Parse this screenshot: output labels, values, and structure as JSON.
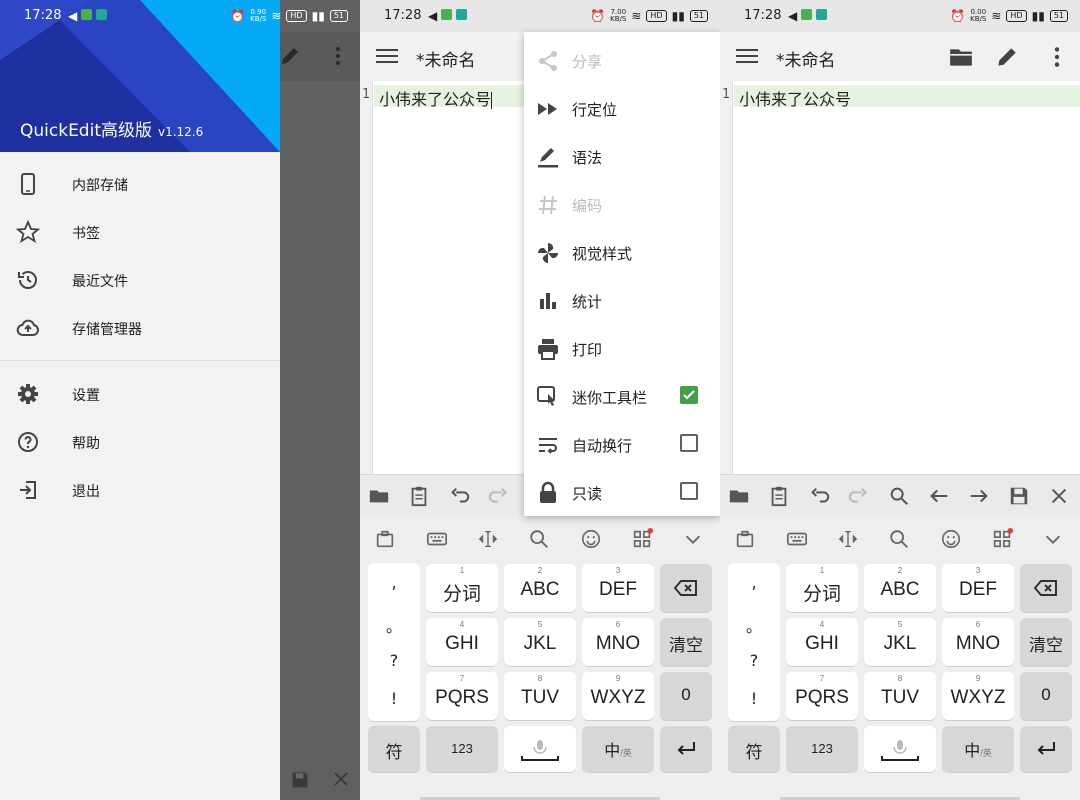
{
  "status_bar": {
    "time": "17:28",
    "speed_p1": "0.90",
    "speed_p2": "7.00",
    "speed_p3": "0.00",
    "speed_unit": "KB/S",
    "hd": "HD",
    "battery": "51"
  },
  "app": {
    "name": "QuickEdit高级版",
    "version": "v1.12.6",
    "doc_title": "*未命名"
  },
  "drawer": {
    "items": [
      {
        "label": "内部存储",
        "icon": "phone-icon"
      },
      {
        "label": "书签",
        "icon": "star-icon"
      },
      {
        "label": "最近文件",
        "icon": "history-icon"
      },
      {
        "label": "存储管理器",
        "icon": "cloud-upload-icon"
      },
      {
        "label": "设置",
        "icon": "gear-icon"
      },
      {
        "label": "帮助",
        "icon": "help-icon"
      },
      {
        "label": "退出",
        "icon": "exit-icon"
      }
    ]
  },
  "editor": {
    "line_number": "1",
    "line_text": "小伟来了公众号"
  },
  "overflow_menu": {
    "items": [
      {
        "label": "分享",
        "icon": "share-icon",
        "enabled": false
      },
      {
        "label": "行定位",
        "icon": "fast-forward-icon",
        "enabled": true
      },
      {
        "label": "语法",
        "icon": "pen-icon",
        "enabled": true
      },
      {
        "label": "编码",
        "icon": "hash-icon",
        "enabled": false
      },
      {
        "label": "视觉样式",
        "icon": "pinwheel-icon",
        "enabled": true
      },
      {
        "label": "统计",
        "icon": "bar-chart-icon",
        "enabled": true
      },
      {
        "label": "打印",
        "icon": "printer-icon",
        "enabled": true
      },
      {
        "label": "迷你工具栏",
        "icon": "touch-icon",
        "enabled": true,
        "checked": true
      },
      {
        "label": "自动换行",
        "icon": "wrap-icon",
        "enabled": true,
        "checked": false
      },
      {
        "label": "只读",
        "icon": "lock-icon",
        "enabled": true,
        "checked": false
      }
    ]
  },
  "keyboard": {
    "punct": [
      ",",
      "。",
      "?",
      "!"
    ],
    "rows": [
      [
        {
          "num": "1",
          "label": "分词"
        },
        {
          "num": "2",
          "label": "ABC"
        },
        {
          "num": "3",
          "label": "DEF"
        }
      ],
      [
        {
          "num": "4",
          "label": "GHI"
        },
        {
          "num": "5",
          "label": "JKL"
        },
        {
          "num": "6",
          "label": "MNO"
        }
      ],
      [
        {
          "num": "7",
          "label": "PQRS"
        },
        {
          "num": "8",
          "label": "TUV"
        },
        {
          "num": "9",
          "label": "WXYZ"
        }
      ]
    ],
    "clear": "清空",
    "zero": "0",
    "sym": "符",
    "num_key": "123",
    "lang_main": "中",
    "lang_sub": "/英"
  },
  "colors": {
    "accent_green": "#43a047",
    "drawer_header_a": "#1e2fa0",
    "drawer_header_b": "#03a9f4",
    "line_highlight": "#e5f2df"
  }
}
